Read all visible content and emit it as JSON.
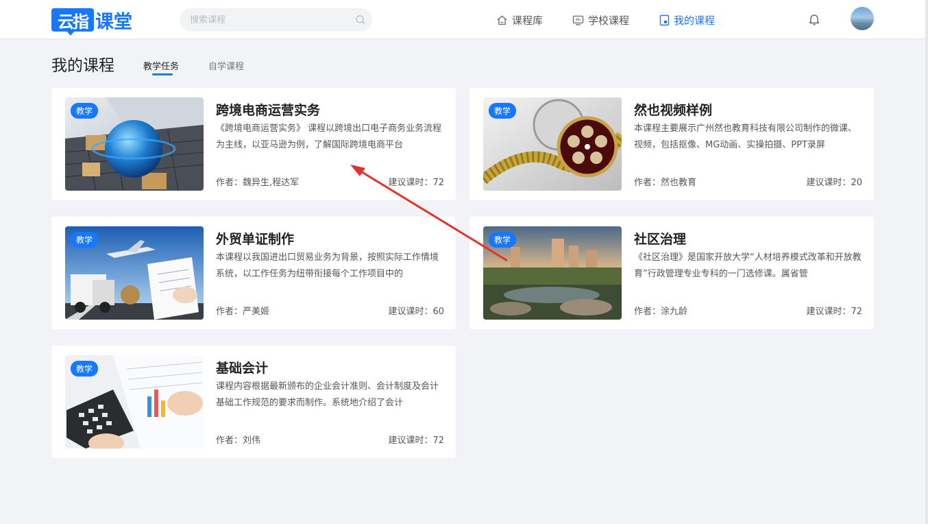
{
  "header": {
    "logo_mark": "云指",
    "logo_text": "课堂",
    "search_placeholder": "搜索课程",
    "nav": [
      {
        "label": "课程库"
      },
      {
        "label": "学校课程"
      },
      {
        "label": "我的课程",
        "active": true
      }
    ]
  },
  "page": {
    "title": "我的课程",
    "tabs": [
      {
        "label": "教学任务",
        "active": true
      },
      {
        "label": "自学课程"
      }
    ]
  },
  "courses": [
    {
      "badge": "教学",
      "title": "跨境电商运营实务",
      "desc": "《跨境电商运营实务》 课程以跨境出口电子商务业务流程为主线，以亚马逊为例，了解国际跨境电商平台",
      "author": "作者：魏异生,程达军",
      "hours": "建议课时：72"
    },
    {
      "badge": "教学",
      "title": "然也视频样例",
      "desc": "本课程主要展示广州然也教育科技有限公司制作的微课、视频，包括抠像、MG动画、实操拍摄、PPT录屏",
      "author": "作者：然也教育",
      "hours": "建议课时：20"
    },
    {
      "badge": "教学",
      "title": "外贸单证制作",
      "desc": "本课程以我国进出口贸易业务为背景，按照实际工作情境系统，以工作任务为纽带衔接每个工作项目中的",
      "author": "作者：严美姬",
      "hours": "建议课时：60"
    },
    {
      "badge": "教学",
      "title": "社区治理",
      "desc": "《社区治理》是国家开放大学“人材培养模式改革和开放教育”行政管理专业专科的一门选修课。属省管",
      "author": "作者：涂九龄",
      "hours": "建议课时：72"
    },
    {
      "badge": "教学",
      "title": "基础会计",
      "desc": "课程内容根据最新颁布的企业会计准则、会计制度及会计基础工作规范的要求而制作。系统地介绍了会计",
      "author": "作者：刘伟",
      "hours": "建议课时：72"
    }
  ],
  "colors": {
    "accent": "#1677ff",
    "annotation_arrow": "#e8302a"
  }
}
